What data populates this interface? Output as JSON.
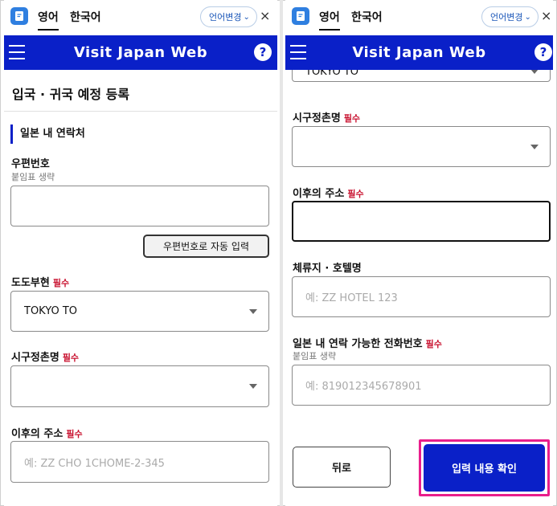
{
  "header": {
    "lang_tab_1": "영어",
    "lang_tab_2": "한국어",
    "lang_change": "언어변경",
    "lang_chevron": "⌄",
    "close": "×"
  },
  "navbar": {
    "title": "Visit Japan Web",
    "help": "?"
  },
  "left": {
    "page_title": "입국 · 귀국 예정 등록",
    "section_title": "일본 내 연락처",
    "postal_label": "우편번호",
    "postal_sub": "붙임표 생략",
    "postal_value": "",
    "postal_button": "우편번호로 자동 입력",
    "pref_label": "도도부현",
    "pref_value": "TOKYO TO",
    "city_label": "시구정촌명",
    "city_value": "",
    "addr_label": "이후의 주소",
    "addr_placeholder": "예: ZZ CHO 1CHOME-2-345"
  },
  "right": {
    "pref_value": "TOKYO TO",
    "city_label": "시구정촌명",
    "city_value": "",
    "addr_label": "이후의 주소",
    "addr_value": "",
    "hotel_label": "체류지 · 호텔명",
    "hotel_placeholder": "예: ZZ HOTEL 123",
    "phone_label": "일본 내 연락 가능한 전화번호",
    "phone_sub": "붙임표 생략",
    "phone_placeholder": "예: 819012345678901",
    "back_button": "뒤로",
    "confirm_button": "입력 내용 확인"
  },
  "required": "필수",
  "colors": {
    "navbar": "#0a20c8",
    "required": "#c8102e",
    "highlight": "#e91e8c"
  }
}
